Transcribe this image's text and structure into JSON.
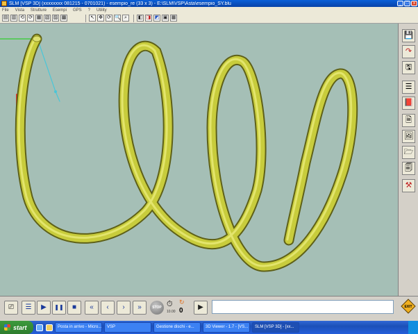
{
  "window": {
    "title": "SLM [VSP 3D] (xxxxxxxx 081215 - 0701021)  - esempio_re (33 x 3)  - E:\\SLM\\VSP\\Asta\\esempio_SY.blu",
    "min_label": "_",
    "max_label": "□",
    "close_label": "x"
  },
  "menu": [
    "File",
    "Vista",
    "Strutture",
    "Esempi",
    "GPS",
    "?",
    "Utility"
  ],
  "toolbar": {
    "buttons": [
      "▤",
      "▥",
      "⟲",
      "⟳",
      "▦",
      "▧",
      "▨",
      "▩"
    ],
    "view_buttons": [
      "↖",
      "✥",
      "⟳",
      "🔍",
      "⌕"
    ],
    "render_buttons": [
      "◧",
      "◨",
      "◩",
      "▣",
      "▦"
    ]
  },
  "sidepanel": {
    "buttons": [
      {
        "icon": "save-disk",
        "glyph": "💾"
      },
      {
        "icon": "curve-edit",
        "glyph": "↷"
      },
      {
        "icon": "save-as-disk",
        "glyph": "🖫"
      },
      {
        "icon": "document-list",
        "glyph": "☰"
      },
      {
        "icon": "book",
        "glyph": "📕"
      },
      {
        "icon": "script-file",
        "glyph": "🗎"
      },
      {
        "icon": "image-file",
        "glyph": "🖼"
      },
      {
        "icon": "open-file",
        "glyph": "🗁"
      },
      {
        "icon": "close-file",
        "glyph": "🗐"
      },
      {
        "icon": "tools",
        "glyph": "⚒"
      }
    ]
  },
  "controls": {
    "play": "▶",
    "pause": "❚❚",
    "stop": "■",
    "rewind": "«",
    "step_back": "‹",
    "step_forward": "›",
    "fast_forward": "»",
    "stop_label": "STOP",
    "timer_value": "0",
    "timer_small": "10.00",
    "command_value": "",
    "exit_label": "EXIT"
  },
  "taskbar": {
    "start_label": "start",
    "tasks": [
      "Posta in arrivo - Micro...",
      "VSP",
      "Gestione dischi - e...",
      "3D Viewer - 1.7 - [VS...",
      "SLM [VSP 3D] - [xx..."
    ]
  },
  "colors": {
    "viewport_bg": "#a5bfb6",
    "helix": "#c8cc3c",
    "axis_x": "#44cc44",
    "axis_y": "#4ac6d8",
    "axis_z": "#e03030"
  }
}
